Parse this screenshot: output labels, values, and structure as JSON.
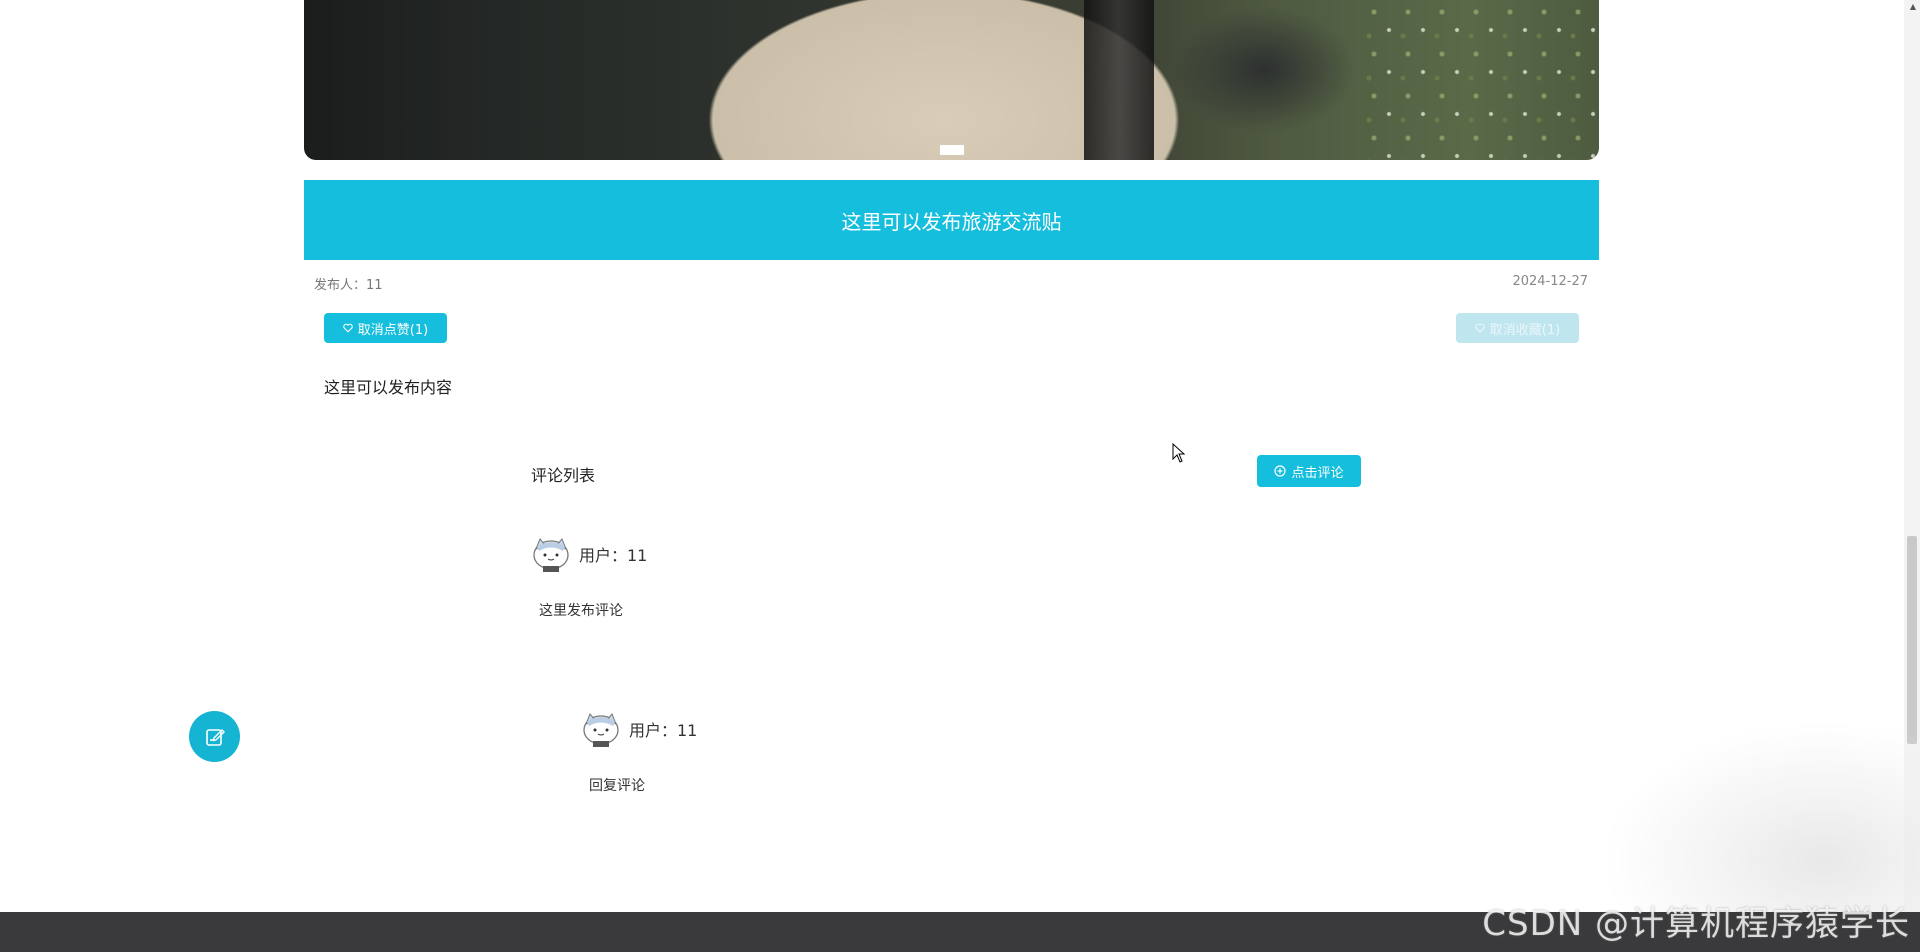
{
  "post": {
    "title": "这里可以发布旅游交流贴",
    "author_label": "发布人：11",
    "date": "2024-12-27",
    "content": "这里可以发布内容"
  },
  "actions": {
    "like_label": "取消点赞(1)",
    "favorite_label": "取消收藏(1)",
    "comment_label": "点击评论"
  },
  "comments": {
    "title": "评论列表",
    "items": [
      {
        "user": "用户：11",
        "text": "这里发布评论"
      },
      {
        "user": "用户：11",
        "text": "回复评论"
      }
    ]
  },
  "watermark": "CSDN @计算机程序猿学长",
  "colors": {
    "accent": "#15bedc",
    "footer": "#3a3a3c"
  }
}
